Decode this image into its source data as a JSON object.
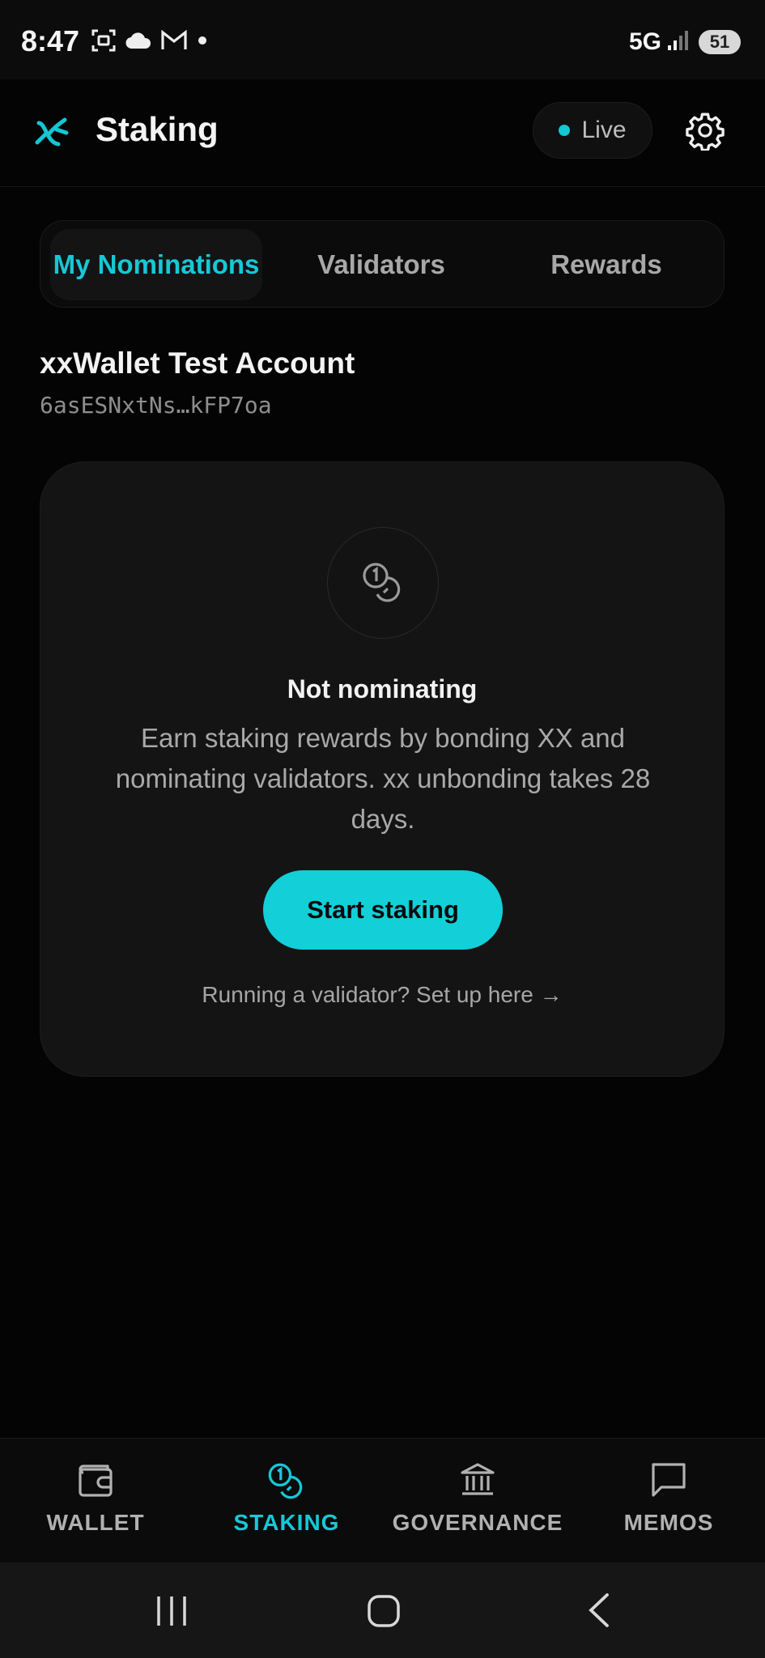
{
  "status_bar": {
    "time": "8:47",
    "network": "5G",
    "battery": "51"
  },
  "header": {
    "title": "Staking",
    "live_label": "Live"
  },
  "tabs": [
    {
      "label": "My Nominations",
      "active": true
    },
    {
      "label": "Validators",
      "active": false
    },
    {
      "label": "Rewards",
      "active": false
    }
  ],
  "account": {
    "name": "xxWallet Test Account",
    "address": "6asESNxtNs…kFP7oa"
  },
  "empty_state": {
    "title": "Not nominating",
    "description": "Earn staking rewards by bonding XX and nominating validators. xx unbonding takes 28 days.",
    "button_label": "Start staking",
    "validator_link": "Running a validator? Set up here →"
  },
  "bottom_nav": [
    {
      "label": "WALLET",
      "icon": "wallet-icon",
      "active": false
    },
    {
      "label": "STAKING",
      "icon": "coins-icon",
      "active": true
    },
    {
      "label": "GOVERNANCE",
      "icon": "governance-icon",
      "active": false
    },
    {
      "label": "MEMOS",
      "icon": "chat-icon",
      "active": false
    }
  ],
  "colors": {
    "accent": "#13c7d3",
    "background": "#040404",
    "card": "#141414"
  }
}
